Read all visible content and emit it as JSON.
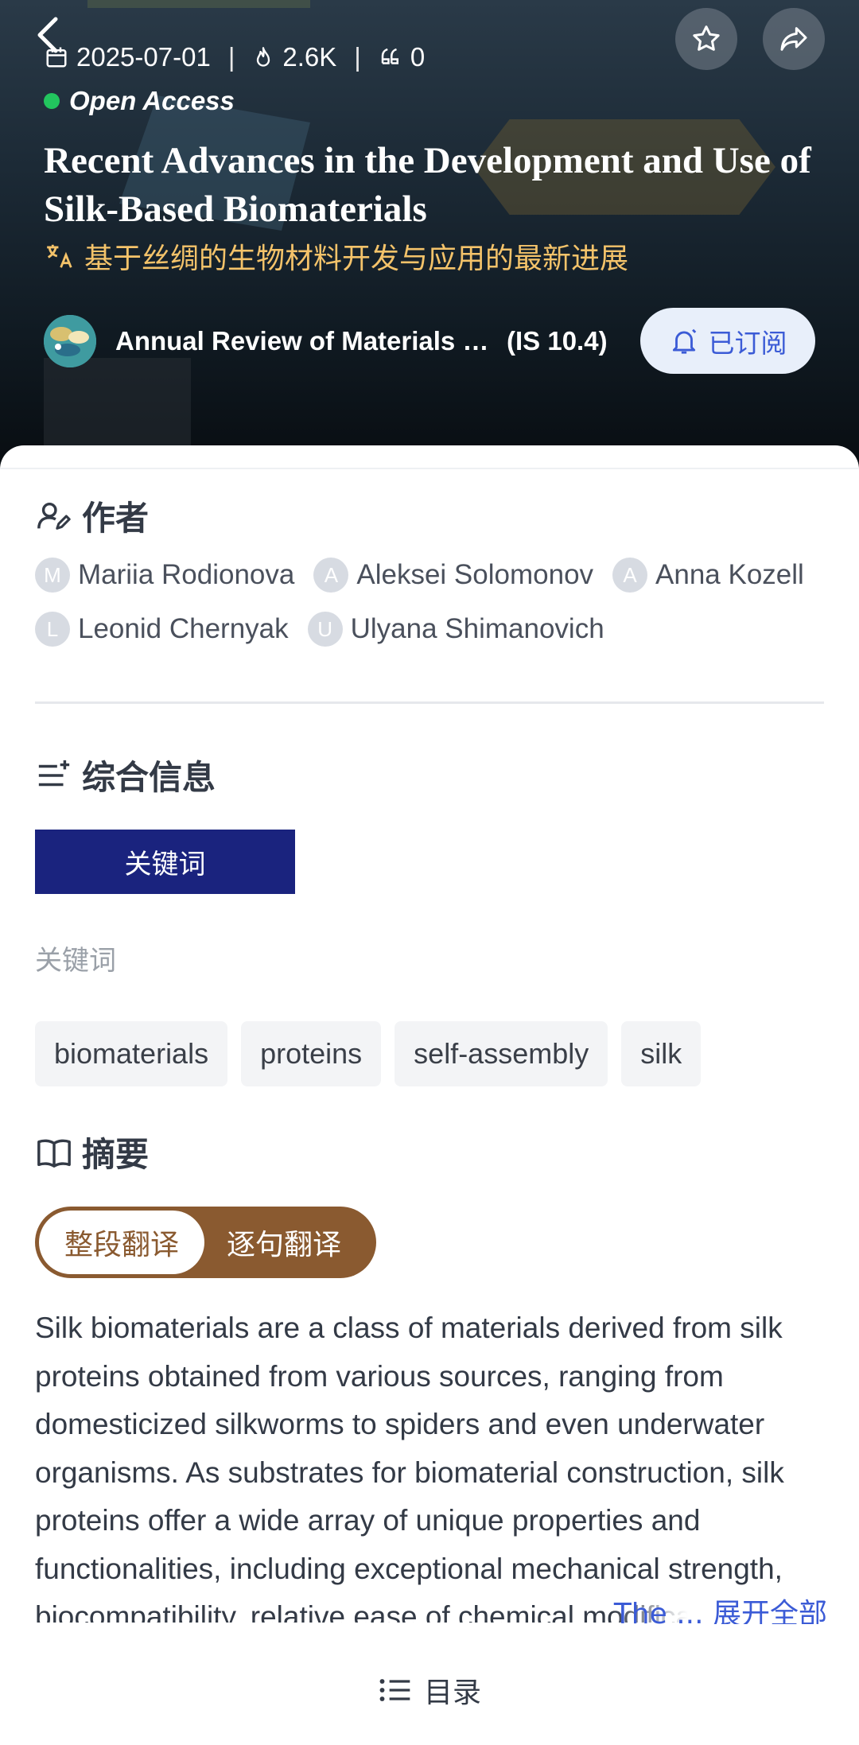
{
  "header": {
    "date": "2025-07-01",
    "views": "2.6K",
    "citations": "0",
    "access_label": "Open Access",
    "title_en": "Recent Advances in the Development and Use of Silk-Based Biomaterials",
    "title_zh": "基于丝绸的生物材料开发与应用的最新进展",
    "journal_name": "Annual Review of Materials Research",
    "impact_factor": "(IS 10.4)",
    "subscribe_label": "已订阅"
  },
  "authors_section": {
    "title": "作者",
    "authors": [
      {
        "initial": "M",
        "name": "Mariia Rodionova"
      },
      {
        "initial": "A",
        "name": "Aleksei Solomonov"
      },
      {
        "initial": "A",
        "name": "Anna Kozell"
      },
      {
        "initial": "L",
        "name": "Leonid Chernyak"
      },
      {
        "initial": "U",
        "name": "Ulyana Shimanovich"
      }
    ]
  },
  "info_section": {
    "title": "综合信息",
    "tab_label": "关键词",
    "keywords_label": "关键词",
    "keywords": [
      "biomaterials",
      "proteins",
      "self-assembly",
      "silk"
    ]
  },
  "abstract_section": {
    "title": "摘要",
    "toggle_paragraph": "整段翻译",
    "toggle_sentence": "逐句翻译",
    "text": "Silk biomaterials are a class of materials derived from silk proteins obtained from various sources, ranging from domesticized silkworms to spiders and even underwater organisms. As substrates for biomaterial construction, silk proteins offer a wide array of unique properties and functionalities, including exceptional mechanical strength, biocompatibility, relative ease of chemical modification, and processa...",
    "expand_label": "The ... 展开全部"
  },
  "footer": {
    "toc_label": "目录"
  },
  "colors": {
    "accent_blue": "#3b5bd6",
    "keyword_tab": "#1a237e",
    "toggle_brown": "#8a5a30",
    "title_zh_gold": "#f4c36a",
    "oa_green": "#22c55e"
  }
}
